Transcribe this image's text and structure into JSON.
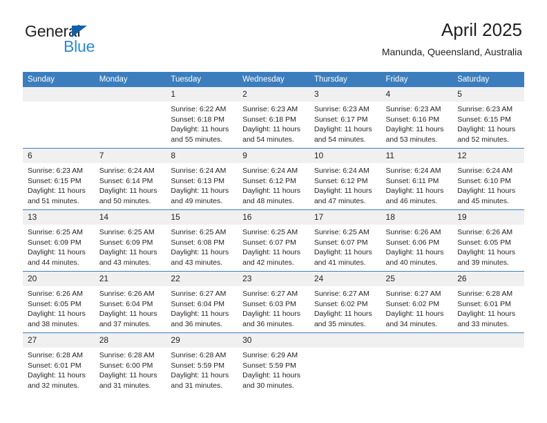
{
  "brand": {
    "name_top": "General",
    "name_bottom": "Blue",
    "triangle_color": "#1060a8",
    "blue_color": "#2a8ad4"
  },
  "header": {
    "title": "April 2025",
    "subtitle": "Manunda, Queensland, Australia"
  },
  "theme": {
    "header_blue": "#3c7ebd",
    "daynum_bg": "#f0f0f0",
    "text": "#231f20"
  },
  "weekday_headers": [
    "Sunday",
    "Monday",
    "Tuesday",
    "Wednesday",
    "Thursday",
    "Friday",
    "Saturday"
  ],
  "labels": {
    "sunrise_prefix": "Sunrise:",
    "sunset_prefix": "Sunset:",
    "daylight_prefix": "Daylight:"
  },
  "weeks": [
    [
      {
        "day": "",
        "blank": true
      },
      {
        "day": "",
        "blank": true
      },
      {
        "day": "1",
        "sunrise": "Sunrise: 6:22 AM",
        "sunset": "Sunset: 6:18 PM",
        "daylight_line1": "Daylight: 11 hours",
        "daylight_line2": "and 55 minutes."
      },
      {
        "day": "2",
        "sunrise": "Sunrise: 6:23 AM",
        "sunset": "Sunset: 6:18 PM",
        "daylight_line1": "Daylight: 11 hours",
        "daylight_line2": "and 54 minutes."
      },
      {
        "day": "3",
        "sunrise": "Sunrise: 6:23 AM",
        "sunset": "Sunset: 6:17 PM",
        "daylight_line1": "Daylight: 11 hours",
        "daylight_line2": "and 54 minutes."
      },
      {
        "day": "4",
        "sunrise": "Sunrise: 6:23 AM",
        "sunset": "Sunset: 6:16 PM",
        "daylight_line1": "Daylight: 11 hours",
        "daylight_line2": "and 53 minutes."
      },
      {
        "day": "5",
        "sunrise": "Sunrise: 6:23 AM",
        "sunset": "Sunset: 6:15 PM",
        "daylight_line1": "Daylight: 11 hours",
        "daylight_line2": "and 52 minutes."
      }
    ],
    [
      {
        "day": "6",
        "sunrise": "Sunrise: 6:23 AM",
        "sunset": "Sunset: 6:15 PM",
        "daylight_line1": "Daylight: 11 hours",
        "daylight_line2": "and 51 minutes."
      },
      {
        "day": "7",
        "sunrise": "Sunrise: 6:24 AM",
        "sunset": "Sunset: 6:14 PM",
        "daylight_line1": "Daylight: 11 hours",
        "daylight_line2": "and 50 minutes."
      },
      {
        "day": "8",
        "sunrise": "Sunrise: 6:24 AM",
        "sunset": "Sunset: 6:13 PM",
        "daylight_line1": "Daylight: 11 hours",
        "daylight_line2": "and 49 minutes."
      },
      {
        "day": "9",
        "sunrise": "Sunrise: 6:24 AM",
        "sunset": "Sunset: 6:12 PM",
        "daylight_line1": "Daylight: 11 hours",
        "daylight_line2": "and 48 minutes."
      },
      {
        "day": "10",
        "sunrise": "Sunrise: 6:24 AM",
        "sunset": "Sunset: 6:12 PM",
        "daylight_line1": "Daylight: 11 hours",
        "daylight_line2": "and 47 minutes."
      },
      {
        "day": "11",
        "sunrise": "Sunrise: 6:24 AM",
        "sunset": "Sunset: 6:11 PM",
        "daylight_line1": "Daylight: 11 hours",
        "daylight_line2": "and 46 minutes."
      },
      {
        "day": "12",
        "sunrise": "Sunrise: 6:24 AM",
        "sunset": "Sunset: 6:10 PM",
        "daylight_line1": "Daylight: 11 hours",
        "daylight_line2": "and 45 minutes."
      }
    ],
    [
      {
        "day": "13",
        "sunrise": "Sunrise: 6:25 AM",
        "sunset": "Sunset: 6:09 PM",
        "daylight_line1": "Daylight: 11 hours",
        "daylight_line2": "and 44 minutes."
      },
      {
        "day": "14",
        "sunrise": "Sunrise: 6:25 AM",
        "sunset": "Sunset: 6:09 PM",
        "daylight_line1": "Daylight: 11 hours",
        "daylight_line2": "and 43 minutes."
      },
      {
        "day": "15",
        "sunrise": "Sunrise: 6:25 AM",
        "sunset": "Sunset: 6:08 PM",
        "daylight_line1": "Daylight: 11 hours",
        "daylight_line2": "and 43 minutes."
      },
      {
        "day": "16",
        "sunrise": "Sunrise: 6:25 AM",
        "sunset": "Sunset: 6:07 PM",
        "daylight_line1": "Daylight: 11 hours",
        "daylight_line2": "and 42 minutes."
      },
      {
        "day": "17",
        "sunrise": "Sunrise: 6:25 AM",
        "sunset": "Sunset: 6:07 PM",
        "daylight_line1": "Daylight: 11 hours",
        "daylight_line2": "and 41 minutes."
      },
      {
        "day": "18",
        "sunrise": "Sunrise: 6:26 AM",
        "sunset": "Sunset: 6:06 PM",
        "daylight_line1": "Daylight: 11 hours",
        "daylight_line2": "and 40 minutes."
      },
      {
        "day": "19",
        "sunrise": "Sunrise: 6:26 AM",
        "sunset": "Sunset: 6:05 PM",
        "daylight_line1": "Daylight: 11 hours",
        "daylight_line2": "and 39 minutes."
      }
    ],
    [
      {
        "day": "20",
        "sunrise": "Sunrise: 6:26 AM",
        "sunset": "Sunset: 6:05 PM",
        "daylight_line1": "Daylight: 11 hours",
        "daylight_line2": "and 38 minutes."
      },
      {
        "day": "21",
        "sunrise": "Sunrise: 6:26 AM",
        "sunset": "Sunset: 6:04 PM",
        "daylight_line1": "Daylight: 11 hours",
        "daylight_line2": "and 37 minutes."
      },
      {
        "day": "22",
        "sunrise": "Sunrise: 6:27 AM",
        "sunset": "Sunset: 6:04 PM",
        "daylight_line1": "Daylight: 11 hours",
        "daylight_line2": "and 36 minutes."
      },
      {
        "day": "23",
        "sunrise": "Sunrise: 6:27 AM",
        "sunset": "Sunset: 6:03 PM",
        "daylight_line1": "Daylight: 11 hours",
        "daylight_line2": "and 36 minutes."
      },
      {
        "day": "24",
        "sunrise": "Sunrise: 6:27 AM",
        "sunset": "Sunset: 6:02 PM",
        "daylight_line1": "Daylight: 11 hours",
        "daylight_line2": "and 35 minutes."
      },
      {
        "day": "25",
        "sunrise": "Sunrise: 6:27 AM",
        "sunset": "Sunset: 6:02 PM",
        "daylight_line1": "Daylight: 11 hours",
        "daylight_line2": "and 34 minutes."
      },
      {
        "day": "26",
        "sunrise": "Sunrise: 6:28 AM",
        "sunset": "Sunset: 6:01 PM",
        "daylight_line1": "Daylight: 11 hours",
        "daylight_line2": "and 33 minutes."
      }
    ],
    [
      {
        "day": "27",
        "sunrise": "Sunrise: 6:28 AM",
        "sunset": "Sunset: 6:01 PM",
        "daylight_line1": "Daylight: 11 hours",
        "daylight_line2": "and 32 minutes."
      },
      {
        "day": "28",
        "sunrise": "Sunrise: 6:28 AM",
        "sunset": "Sunset: 6:00 PM",
        "daylight_line1": "Daylight: 11 hours",
        "daylight_line2": "and 31 minutes."
      },
      {
        "day": "29",
        "sunrise": "Sunrise: 6:28 AM",
        "sunset": "Sunset: 5:59 PM",
        "daylight_line1": "Daylight: 11 hours",
        "daylight_line2": "and 31 minutes."
      },
      {
        "day": "30",
        "sunrise": "Sunrise: 6:29 AM",
        "sunset": "Sunset: 5:59 PM",
        "daylight_line1": "Daylight: 11 hours",
        "daylight_line2": "and 30 minutes."
      },
      {
        "day": "",
        "blank": true
      },
      {
        "day": "",
        "blank": true
      },
      {
        "day": "",
        "blank": true
      }
    ]
  ]
}
